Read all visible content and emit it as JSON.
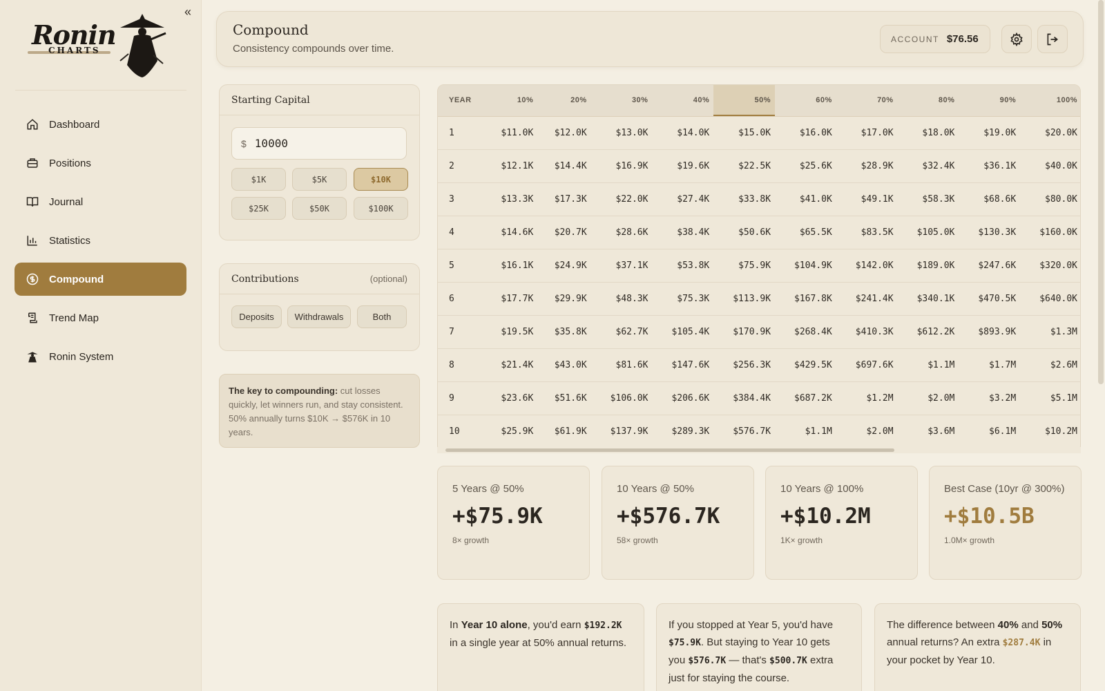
{
  "sidebar": {
    "logo": {
      "line1": "Ronin",
      "line2": "CHARTS"
    },
    "items": [
      {
        "label": "Dashboard",
        "icon": "home-icon"
      },
      {
        "label": "Positions",
        "icon": "briefcase-icon"
      },
      {
        "label": "Journal",
        "icon": "book-icon"
      },
      {
        "label": "Statistics",
        "icon": "bar-chart-icon"
      },
      {
        "label": "Compound",
        "icon": "dollar-circle-icon",
        "active": true
      },
      {
        "label": "Trend Map",
        "icon": "scroll-icon"
      },
      {
        "label": "Ronin System",
        "icon": "ronin-figure-icon"
      }
    ]
  },
  "header": {
    "title": "Compound",
    "subtitle": "Consistency compounds over time.",
    "account_label": "ACCOUNT",
    "account_value": "$76.56"
  },
  "capital": {
    "title": "Starting Capital",
    "currency": "$",
    "value": "10000",
    "presets": [
      "$1K",
      "$5K",
      "$10K",
      "$25K",
      "$50K",
      "$100K"
    ],
    "selected": "$10K"
  },
  "contributions": {
    "title": "Contributions",
    "optional": "(optional)",
    "options": [
      "Deposits",
      "Withdrawals",
      "Both"
    ]
  },
  "tip": {
    "bold": "The key to compounding:",
    "text": " cut losses quickly, let winners run, and stay consistent. 50% annually turns $10K → $576K in 10 years."
  },
  "table": {
    "headers": [
      "YEAR",
      "10%",
      "20%",
      "30%",
      "40%",
      "50%",
      "60%",
      "70%",
      "80%",
      "90%",
      "100%"
    ],
    "highlight_col": "50%",
    "rows": [
      [
        "1",
        "$11.0K",
        "$12.0K",
        "$13.0K",
        "$14.0K",
        "$15.0K",
        "$16.0K",
        "$17.0K",
        "$18.0K",
        "$19.0K",
        "$20.0K"
      ],
      [
        "2",
        "$12.1K",
        "$14.4K",
        "$16.9K",
        "$19.6K",
        "$22.5K",
        "$25.6K",
        "$28.9K",
        "$32.4K",
        "$36.1K",
        "$40.0K"
      ],
      [
        "3",
        "$13.3K",
        "$17.3K",
        "$22.0K",
        "$27.4K",
        "$33.8K",
        "$41.0K",
        "$49.1K",
        "$58.3K",
        "$68.6K",
        "$80.0K"
      ],
      [
        "4",
        "$14.6K",
        "$20.7K",
        "$28.6K",
        "$38.4K",
        "$50.6K",
        "$65.5K",
        "$83.5K",
        "$105.0K",
        "$130.3K",
        "$160.0K"
      ],
      [
        "5",
        "$16.1K",
        "$24.9K",
        "$37.1K",
        "$53.8K",
        "$75.9K",
        "$104.9K",
        "$142.0K",
        "$189.0K",
        "$247.6K",
        "$320.0K"
      ],
      [
        "6",
        "$17.7K",
        "$29.9K",
        "$48.3K",
        "$75.3K",
        "$113.9K",
        "$167.8K",
        "$241.4K",
        "$340.1K",
        "$470.5K",
        "$640.0K"
      ],
      [
        "7",
        "$19.5K",
        "$35.8K",
        "$62.7K",
        "$105.4K",
        "$170.9K",
        "$268.4K",
        "$410.3K",
        "$612.2K",
        "$893.9K",
        "$1.3M"
      ],
      [
        "8",
        "$21.4K",
        "$43.0K",
        "$81.6K",
        "$147.6K",
        "$256.3K",
        "$429.5K",
        "$697.6K",
        "$1.1M",
        "$1.7M",
        "$2.6M"
      ],
      [
        "9",
        "$23.6K",
        "$51.6K",
        "$106.0K",
        "$206.6K",
        "$384.4K",
        "$687.2K",
        "$1.2M",
        "$2.0M",
        "$3.2M",
        "$5.1M"
      ],
      [
        "10",
        "$25.9K",
        "$61.9K",
        "$137.9K",
        "$289.3K",
        "$576.7K",
        "$1.1M",
        "$2.0M",
        "$3.6M",
        "$6.1M",
        "$10.2M"
      ]
    ]
  },
  "stats": [
    {
      "label": "5 Years @ 50%",
      "value": "+$75.9K",
      "sub": "8× growth"
    },
    {
      "label": "10 Years @ 50%",
      "value": "+$576.7K",
      "sub": "58× growth"
    },
    {
      "label": "10 Years @ 100%",
      "value": "+$10.2M",
      "sub": "1K× growth"
    },
    {
      "label": "Best Case (10yr @ 300%)",
      "value": "+$10.5B",
      "sub": "1.0M× growth"
    }
  ],
  "insights": {
    "a": {
      "t1": "In ",
      "b1": "Year 10 alone",
      "t2": ", you'd earn ",
      "n1": "$192.2K",
      "t3": " in a single year at 50% annual returns."
    },
    "b": {
      "t1": "If you stopped at Year 5, you'd have ",
      "n1": "$75.9K",
      "t2": ". But staying to Year 10 gets you ",
      "n2": "$576.7K",
      "t3": " — that's ",
      "n3": "$500.7K",
      "t4": " extra just for staying the course."
    },
    "c": {
      "t1": "The difference between ",
      "b1": "40%",
      "t2": " and ",
      "b2": "50%",
      "t3": " annual returns? An extra ",
      "n1": "$287.4K",
      "t4": " in your pocket by Year 10."
    }
  },
  "colors": {
    "accent": "#a07c3e",
    "background": "#f4efe3",
    "card": "#efe8d9"
  }
}
